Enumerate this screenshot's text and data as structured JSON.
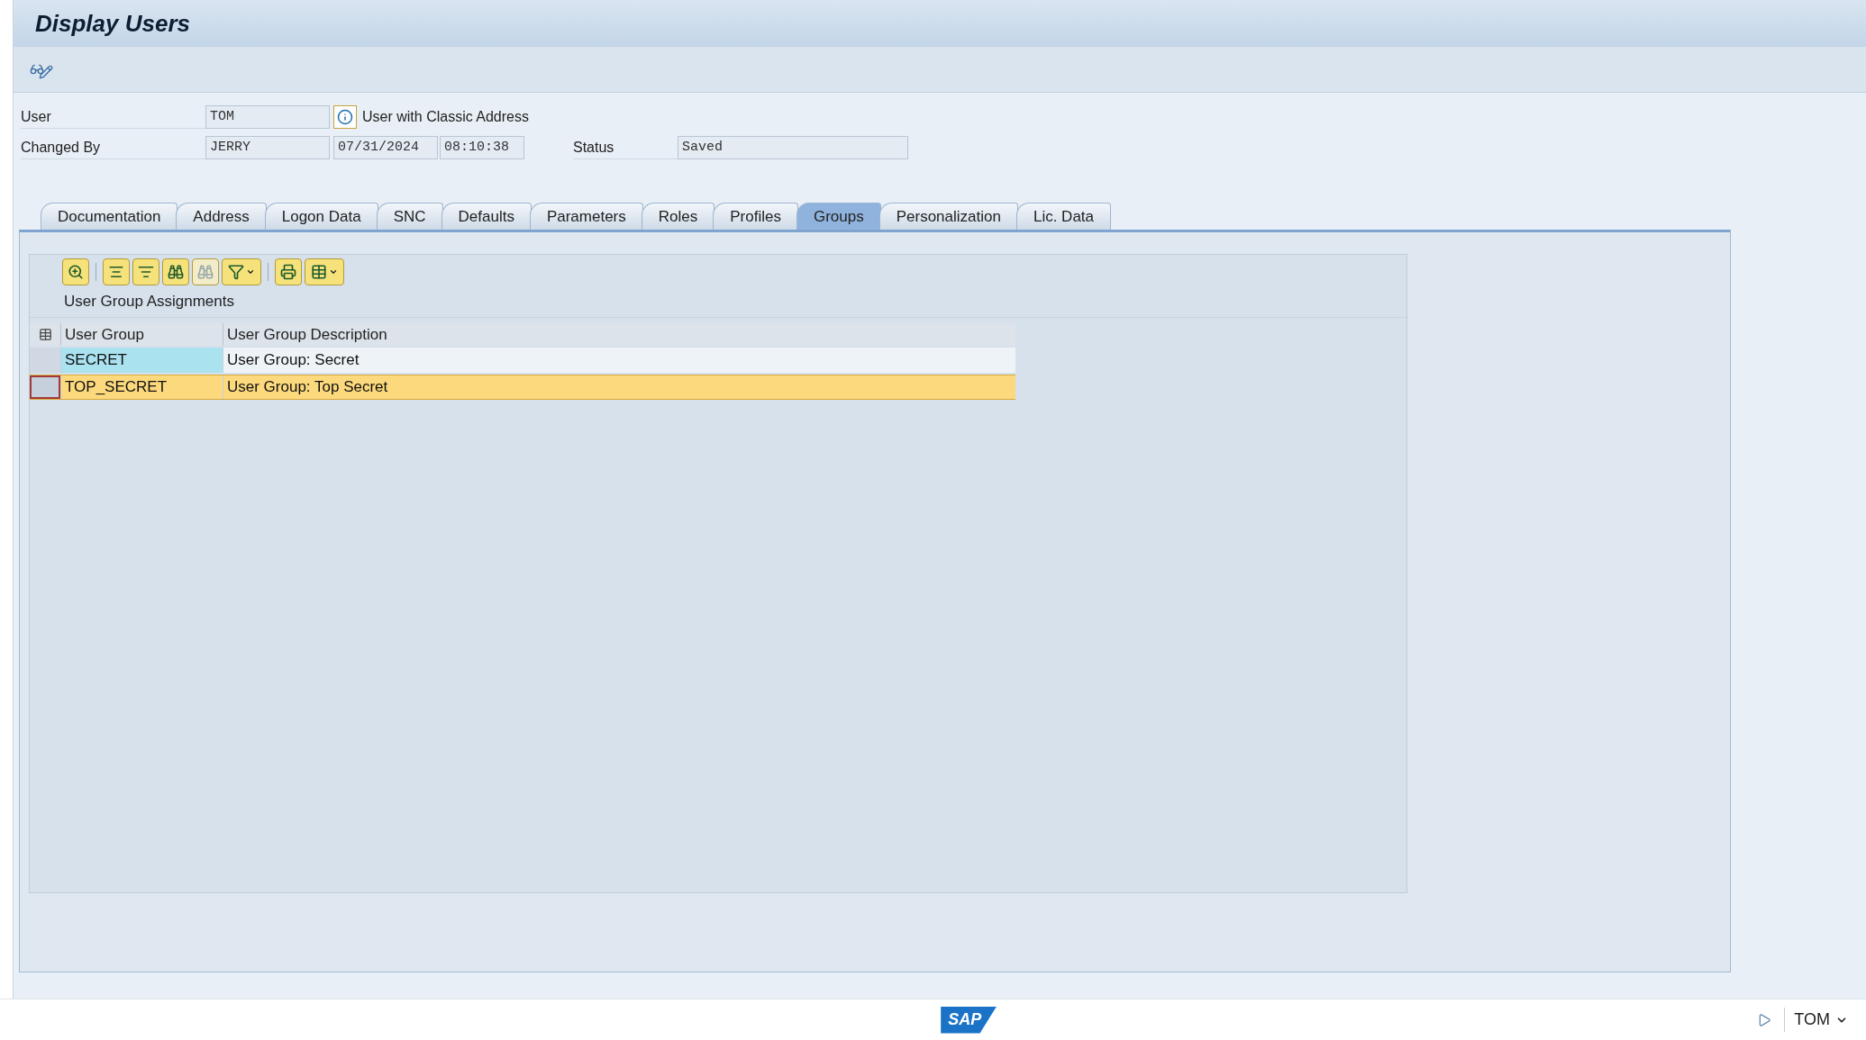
{
  "window": {
    "title": "Display Users"
  },
  "header": {
    "user_label": "User",
    "user_value": "TOM",
    "user_info": "User with Classic Address",
    "changed_by_label": "Changed By",
    "changed_by_value": "JERRY",
    "date": "07/31/2024",
    "time": "08:10:38",
    "status_label": "Status",
    "status_value": "Saved"
  },
  "tabs": [
    {
      "label": "Documentation",
      "selected": false
    },
    {
      "label": "Address",
      "selected": false
    },
    {
      "label": "Logon Data",
      "selected": false
    },
    {
      "label": "SNC",
      "selected": false
    },
    {
      "label": "Defaults",
      "selected": false
    },
    {
      "label": "Parameters",
      "selected": false
    },
    {
      "label": "Roles",
      "selected": false
    },
    {
      "label": "Profiles",
      "selected": false
    },
    {
      "label": "Groups",
      "selected": true
    },
    {
      "label": "Personalization",
      "selected": false
    },
    {
      "label": "Lic. Data",
      "selected": false
    }
  ],
  "grid": {
    "title": "User Group Assignments",
    "toolbar": [
      {
        "kind": "details",
        "disabled": false
      },
      {
        "kind": "sep"
      },
      {
        "kind": "sort_asc",
        "disabled": false
      },
      {
        "kind": "sort_desc",
        "disabled": false
      },
      {
        "kind": "find",
        "disabled": false
      },
      {
        "kind": "find_next",
        "disabled": true
      },
      {
        "kind": "filter",
        "disabled": false
      },
      {
        "kind": "sep"
      },
      {
        "kind": "print",
        "disabled": false
      },
      {
        "kind": "layout",
        "disabled": false
      }
    ],
    "columns": [
      "User Group",
      "User Group Description"
    ],
    "rows": [
      {
        "cells": [
          "SECRET",
          "User Group: Secret"
        ],
        "selected": false
      },
      {
        "cells": [
          "TOP_SECRET",
          "User Group: Top Secret"
        ],
        "selected": true
      }
    ]
  },
  "status_bar": {
    "logo": "SAP",
    "user": "TOM"
  }
}
